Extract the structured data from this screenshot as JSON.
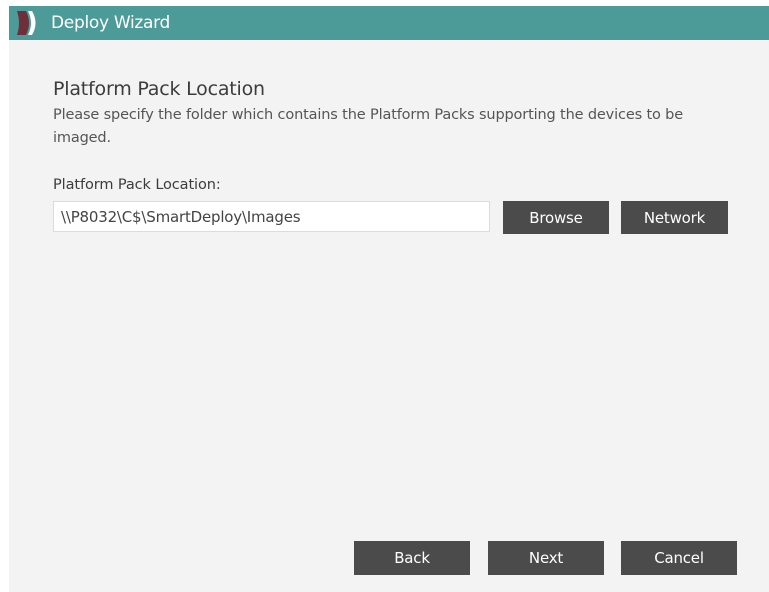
{
  "window": {
    "title": "Deploy Wizard",
    "accent_color": "#4d9b98",
    "logo_icon": "smartdeploy-chevron-logo"
  },
  "page": {
    "heading": "Platform Pack Location",
    "description": "Please specify the folder which contains the Platform Packs supporting the devices to be imaged."
  },
  "location": {
    "label": "Platform Pack Location:",
    "value": "\\\\P8032\\C$\\SmartDeploy\\Images",
    "browse_label": "Browse",
    "network_label": "Network"
  },
  "footer": {
    "back_label": "Back",
    "next_label": "Next",
    "cancel_label": "Cancel"
  }
}
